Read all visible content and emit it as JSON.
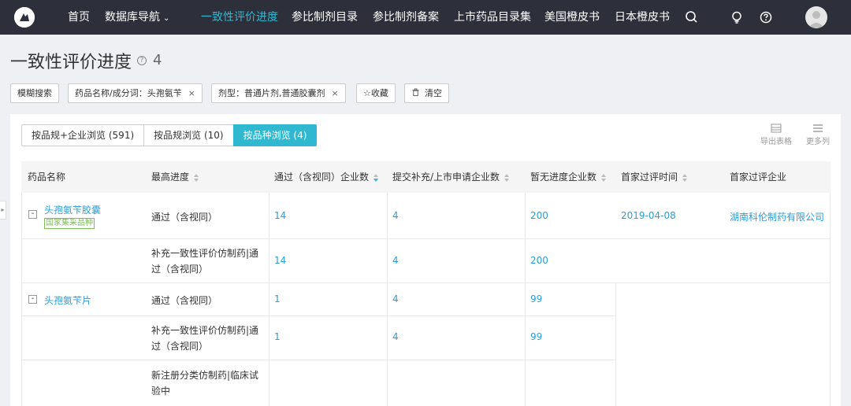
{
  "nav": {
    "items": [
      "首页",
      "数据库导航",
      "一致性评价进度",
      "参比制剂目录",
      "参比制剂备案",
      "上市药品目录集",
      "美国橙皮书",
      "日本橙皮书"
    ],
    "active_index": 2,
    "accent_color": "#2fb8d0",
    "bg_color": "#2d2f3b",
    "icons": [
      "search-icon",
      "lightbulb-icon",
      "help-icon",
      "user-avatar"
    ]
  },
  "page": {
    "title": "一致性评价进度",
    "count": "4"
  },
  "filters": {
    "fuzzy": "模糊搜索",
    "drug_label": "药品名称/成分词：",
    "drug_value": "头孢氨苄",
    "dosage_label": "剂型：",
    "dosage_value": "普通片剂,普通胶囊剂",
    "favorite": "☆收藏",
    "clear": "清空",
    "close_symbol": "×"
  },
  "tabs": [
    "按品规+企业浏览 (591)",
    "按品规浏览 (10)",
    "按品种浏览 (4)"
  ],
  "tab_active": 2,
  "tools": {
    "export": "导出表格",
    "more_cols": "更多列"
  },
  "table": {
    "headers": [
      "药品名称",
      "最高进度",
      "通过（含视同）企业数",
      "提交补充/上市申请企业数",
      "暂无进度企业数",
      "首家过评时间",
      "首家过评企业"
    ],
    "groups": [
      {
        "drug": "头孢氨苄胶囊",
        "tag": "国家集采品种",
        "first_time": "2019-04-08",
        "first_company": "湖南科伦制药有限公司",
        "rows": [
          {
            "progress": "通过（含视同）",
            "passed": "14",
            "submitted": "4",
            "none": "200"
          },
          {
            "progress": "补充一致性评价仿制药|通过（含视同）",
            "passed": "14",
            "submitted": "4",
            "none": "200"
          }
        ]
      },
      {
        "drug": "头孢氨苄片",
        "tag": "",
        "first_time": "",
        "first_company": "",
        "rows": [
          {
            "progress": "通过（含视同）",
            "passed": "1",
            "submitted": "4",
            "none": "99"
          },
          {
            "progress": "补充一致性评价仿制药|通过（含视同）",
            "passed": "1",
            "submitted": "4",
            "none": "99"
          },
          {
            "progress": "新注册分类仿制药|临床试验中",
            "passed": "",
            "submitted": "",
            "none": ""
          }
        ]
      }
    ],
    "collapse_symbol": "-"
  }
}
